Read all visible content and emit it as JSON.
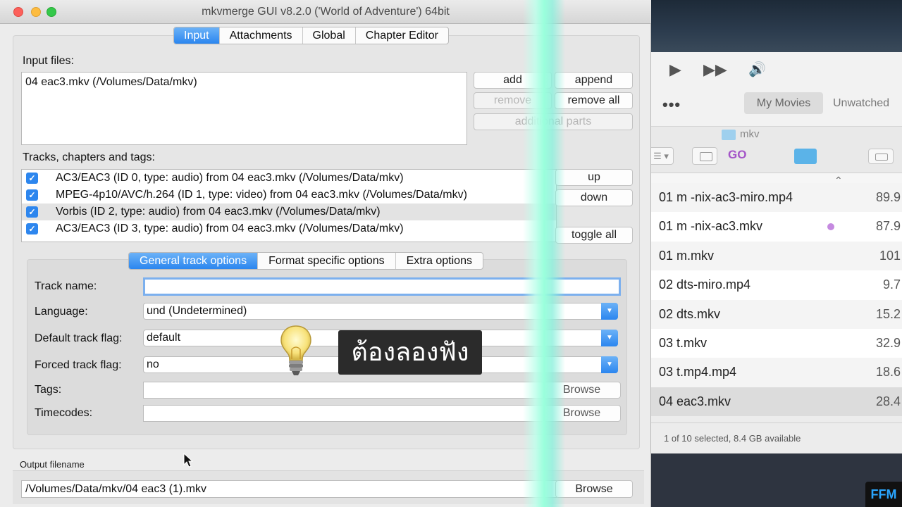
{
  "mkvmerge": {
    "title": "mkvmerge GUI v8.2.0 ('World of Adventure') 64bit",
    "tabs": [
      "Input",
      "Attachments",
      "Global",
      "Chapter Editor"
    ],
    "input_files_label": "Input files:",
    "input_files": [
      "04 eac3.mkv (/Volumes/Data/mkv)"
    ],
    "buttons": {
      "add": "add",
      "append": "append",
      "remove": "remove",
      "remove_all": "remove all",
      "additional_parts": "additional parts"
    },
    "tracks_label": "Tracks, chapters and tags:",
    "tracks": [
      "AC3/EAC3 (ID 0, type: audio) from 04 eac3.mkv (/Volumes/Data/mkv)",
      "MPEG-4p10/AVC/h.264 (ID 1, type: video) from 04 eac3.mkv (/Volumes/Data/mkv)",
      "Vorbis (ID 2, type: audio) from 04 eac3.mkv (/Volumes/Data/mkv)",
      "AC3/EAC3 (ID 3, type: audio) from 04 eac3.mkv (/Volumes/Data/mkv)"
    ],
    "track_buttons": {
      "up": "up",
      "down": "down",
      "toggle_all": "toggle all"
    },
    "option_tabs": [
      "General track options",
      "Format specific options",
      "Extra options"
    ],
    "fields": {
      "track_name_label": "Track name:",
      "track_name_value": "",
      "language_label": "Language:",
      "language_value": "und (Undetermined)",
      "default_flag_label": "Default track flag:",
      "default_flag_value": "default",
      "forced_flag_label": "Forced track flag:",
      "forced_flag_value": "no",
      "tags_label": "Tags:",
      "timecodes_label": "Timecodes:",
      "browse": "Browse"
    },
    "output_label": "Output filename",
    "output_value": "/Volumes/Data/mkv/04 eac3 (1).mkv",
    "output_browse": "Browse"
  },
  "finder": {
    "more": "•••",
    "segments": [
      "My Movies",
      "Unwatched"
    ],
    "path": "mkv",
    "go": "GO",
    "files": [
      {
        "name": "01 m -nix-ac3-miro.mp4",
        "size": "89.9"
      },
      {
        "name": "01 m -nix-ac3.mkv",
        "size": "87.9"
      },
      {
        "name": "01 m.mkv",
        "size": "101"
      },
      {
        "name": "02 dts-miro.mp4",
        "size": "9.7"
      },
      {
        "name": "02 dts.mkv",
        "size": "15.2"
      },
      {
        "name": "03 t.mkv",
        "size": "32.9"
      },
      {
        "name": "03 t.mp4.mp4",
        "size": "18.6"
      },
      {
        "name": "04 eac3.mkv",
        "size": "28.4"
      }
    ],
    "status": "1 of 10 selected, 8.4 GB available",
    "logo": "FFM"
  },
  "overlay": {
    "caption": "ต้องลองฟัง"
  },
  "colors": {
    "accent": "#2b86ef",
    "tag_purple": "#c58ae0",
    "go_purple": "#a455c8"
  }
}
